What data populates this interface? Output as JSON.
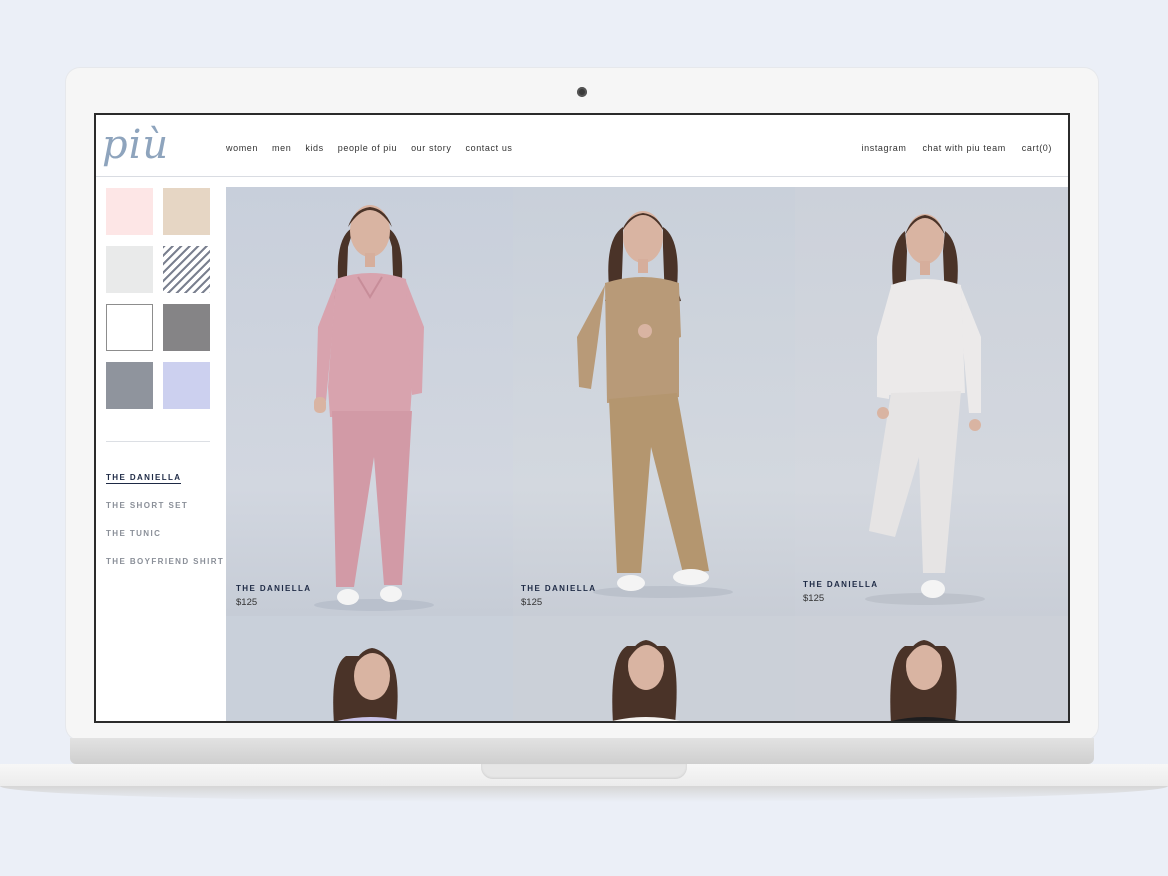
{
  "site": {
    "logo": "più"
  },
  "nav": {
    "left": [
      "women",
      "men",
      "kids",
      "people of piu",
      "our story",
      "contact us"
    ],
    "right": [
      "instagram",
      "chat with piu team",
      "cart(0)"
    ]
  },
  "swatches": [
    {
      "color": "#fde6e6"
    },
    {
      "color": "#e6d6c4"
    },
    {
      "color": "#e9eaea"
    },
    {
      "color": "striped"
    },
    {
      "color": "#ffffff"
    },
    {
      "color": "#858486"
    },
    {
      "color": "#8f949d"
    },
    {
      "color": "#ccd0ef"
    }
  ],
  "styles": [
    {
      "label": "THE DANIELLA",
      "active": true
    },
    {
      "label": "THE SHORT SET",
      "active": false
    },
    {
      "label": "THE TUNIC",
      "active": false
    },
    {
      "label": "THE BOYFRIEND SHIRT",
      "active": false
    }
  ],
  "products": [
    {
      "name": "THE DANIELLA",
      "price": "$125",
      "color": "pink"
    },
    {
      "name": "THE DANIELLA",
      "price": "$125",
      "color": "tan"
    },
    {
      "name": "THE DANIELLA",
      "price": "$125",
      "color": "white"
    }
  ],
  "colors": {
    "pink": "#d8a3ae",
    "tan": "#b89a78",
    "white": "#eceaea",
    "accent": "#1e2a45",
    "logo": "#8ea4bd"
  }
}
